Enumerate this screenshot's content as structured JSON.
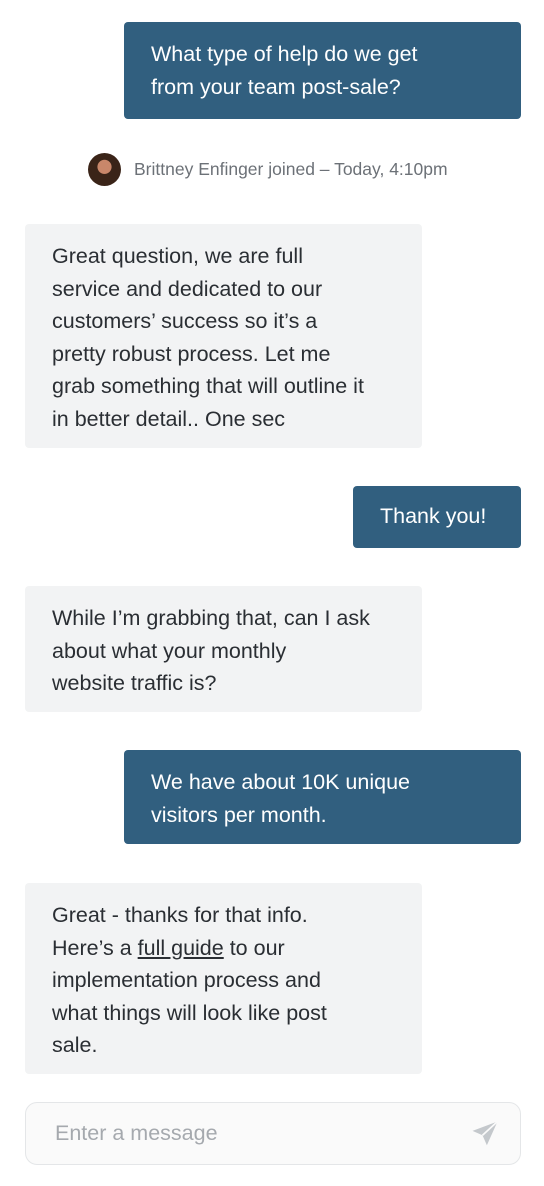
{
  "messages": [
    {
      "from": "visitor",
      "lines": [
        "What type of help do we get",
        "from your team post-sale?"
      ]
    },
    {
      "from": "agent",
      "lines": [
        "Great question, we are full",
        "service and dedicated to our",
        "customers’ success so it’s a",
        "pretty robust process. Let me",
        "grab something that will outline it",
        "in better detail.. One sec"
      ]
    },
    {
      "from": "visitor",
      "lines": [
        "Thank you!"
      ]
    },
    {
      "from": "agent",
      "lines": [
        "While I’m grabbing that, can I ask",
        "about what your monthly",
        "website traffic is?"
      ]
    },
    {
      "from": "visitor",
      "lines": [
        "We have about 10K unique",
        "visitors per month."
      ]
    },
    {
      "from": "agent",
      "lines": [
        "Great - thanks for that info.",
        "Here’s a ",
        "full guide",
        " to our",
        "implementation process and",
        "what things will look like post",
        "sale."
      ]
    }
  ],
  "join_notice": {
    "text": "Brittney Enfinger joined – Today, 4:10pm"
  },
  "composer": {
    "placeholder": "Enter a message",
    "send_icon": "paper-plane-icon"
  },
  "colors": {
    "visitor_bubble": "#315f7f",
    "agent_bubble": "#f2f3f4",
    "meta_text": "#6c7177"
  }
}
